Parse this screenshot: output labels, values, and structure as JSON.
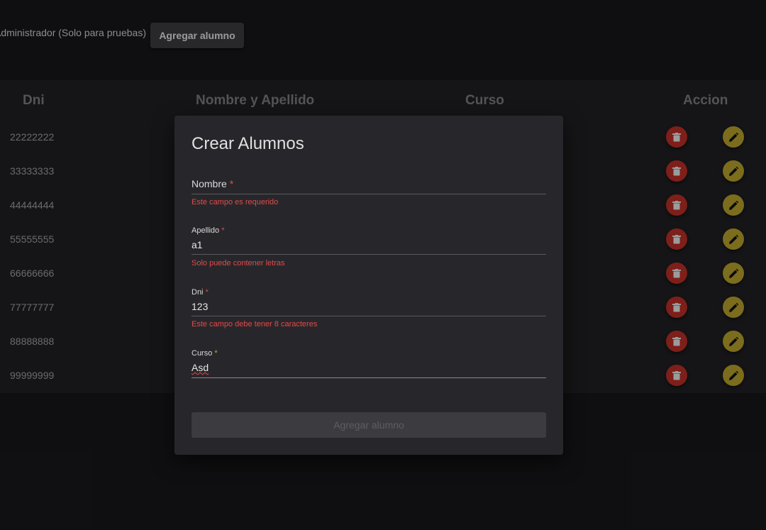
{
  "header": {
    "admin_text": "Administrador (Solo para pruebas)",
    "add_button_label": "Agregar alumno"
  },
  "table": {
    "columns": [
      "Dni",
      "Nombre y Apellido",
      "Curso",
      "Accion"
    ],
    "rows": [
      {
        "dni": "22222222"
      },
      {
        "dni": "33333333"
      },
      {
        "dni": "44444444"
      },
      {
        "dni": "55555555"
      },
      {
        "dni": "66666666"
      },
      {
        "dni": "77777777"
      },
      {
        "dni": "88888888"
      },
      {
        "dni": "99999999"
      }
    ],
    "delete_icon": "trash-icon",
    "edit_icon": "pencil-icon"
  },
  "dialog": {
    "title": "Crear Alumnos",
    "fields": [
      {
        "label": "Nombre",
        "required_mark": "*",
        "value": "",
        "error": "Este campo es requerido"
      },
      {
        "label": "Apellido",
        "required_mark": "*",
        "value": "a1",
        "error": "Solo puede contener letras"
      },
      {
        "label": "Dni",
        "required_mark": "*",
        "value": "123",
        "error": "Este campo debe tener 8 caracteres"
      },
      {
        "label": "Curso",
        "required_mark": "*",
        "value": "Asd",
        "error": ""
      }
    ],
    "submit_label": "Agregar alumno"
  },
  "colors": {
    "background": "#17171a",
    "table_background": "#1f1f22",
    "dialog_background": "#27272b",
    "delete_button": "#ba2f27",
    "edit_button": "#b5a12c",
    "error_text": "#e24a4a"
  }
}
